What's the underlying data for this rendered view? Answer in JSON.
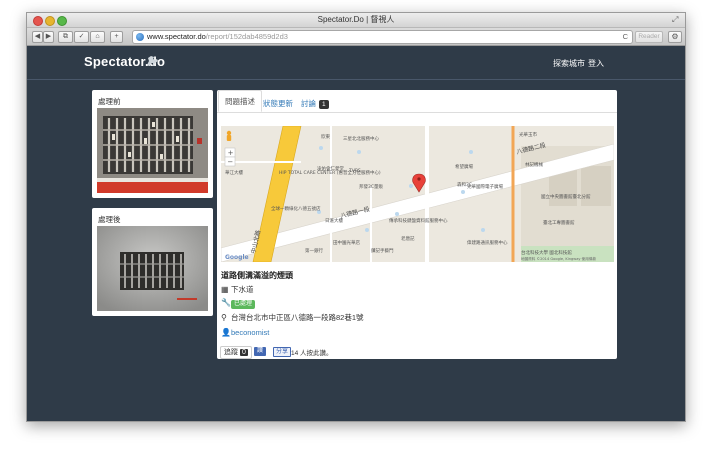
{
  "browser": {
    "window_title": "Spectator.Do | 督視人",
    "url_domain": "www.spectator.do",
    "url_path": "/report/152dab4859d2d3",
    "reader_label": "Reader",
    "reload_glyph": "C",
    "fullscreen_glyph": "⤢",
    "nav_glyphs": [
      "◀",
      "▶",
      "⧉",
      "✓",
      "⌂",
      "+"
    ],
    "gear_glyph": "⚙"
  },
  "site": {
    "brand": "Spectator.do",
    "brand_icon": "dinosaur-icon",
    "nav": {
      "explore": "探索城市",
      "login": "登入"
    }
  },
  "photos": {
    "before_label": "處理前",
    "after_label": "處理後"
  },
  "tabs": [
    {
      "label": "問題描述",
      "active": true
    },
    {
      "label": "狀態更新",
      "active": false
    },
    {
      "label": "討論",
      "badge": "1",
      "active": false
    }
  ],
  "map": {
    "zoom_in": "+",
    "zoom_out": "−",
    "labels": {
      "road1": "八德路一段",
      "road2": "八德路二段",
      "road_zs": "中山北路",
      "xindong": "欣東",
      "tvbs": "TVBS",
      "bldg_huaji": "華江大樓",
      "hip_total": "HIP TOTAL CARE CENTER (惠普全方位服務中心)",
      "three_star": "三星北北服務中心",
      "lingyi": "凌佑會仁愛堂",
      "bluestar": "邦發3C量販",
      "xiyang": "希望廣場",
      "guangbri": "光華玉市",
      "linji": "林記機械",
      "guanghua_mall": "光華國際電子廣場",
      "zhongxin": "全球一顆綠化八德五號店",
      "senhe": "森和3C",
      "chuanyun": "傳承科技鍵盤資料館服務中心",
      "rihui": "日滙大樓",
      "yiyin": "第一銀行",
      "tienzhong": "田中園光華店",
      "weilong": "偉建路通訊服務中心",
      "yuanji": "鑽記手藝門",
      "laotang": "老唐記",
      "guoli": "國立中央圖書館臺北分館",
      "taipei_eng": "臺北工專圖書館",
      "ntut": "台北科技大學 國北科技館",
      "copyright": "地圖資料 ©2014 Google, Kingway  使用條款",
      "google": "Google"
    }
  },
  "issue": {
    "title": "道路側溝滿溢的煙頭",
    "category_icon": "grid-icon",
    "category": "下水道",
    "status_icon": "wrench-icon",
    "status": "已處理",
    "location_icon": "map-marker-icon",
    "address": "台灣台北市中正區八德路一段路82巷1號",
    "user_icon": "user-icon",
    "username": "beconomist"
  },
  "actions": {
    "follow_label": "追蹤",
    "follow_count": "0",
    "fb_label": "讚",
    "share_label": "分享",
    "like_text": "14 人按此讚。"
  }
}
